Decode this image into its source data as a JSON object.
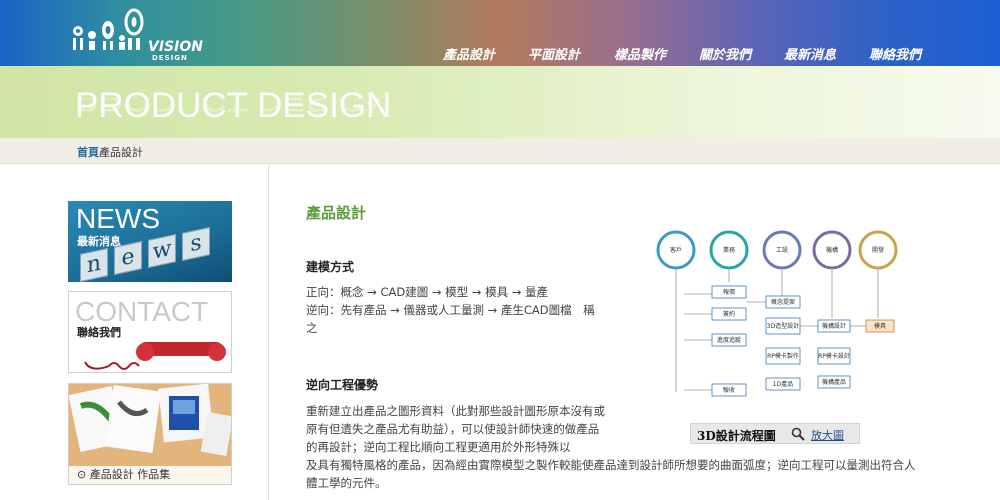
{
  "brand": {
    "name": "VISION",
    "sub": "DESIGN"
  },
  "nav": [
    {
      "label": "產品設計"
    },
    {
      "label": "平面設計"
    },
    {
      "label": "樣品製作"
    },
    {
      "label": "關於我們"
    },
    {
      "label": "最新消息"
    },
    {
      "label": "聯絡我們"
    }
  ],
  "banner": {
    "title": "PRODUCT DESIGN"
  },
  "breadcrumb": {
    "home": "首頁",
    "current": "產品設計"
  },
  "sidebar": {
    "news": {
      "big": "NEWS",
      "sub": "最新消息",
      "keys": [
        "n",
        "e",
        "w",
        "s"
      ]
    },
    "contact": {
      "big": "CONTACT",
      "sub": "聯絡我們"
    },
    "works": {
      "label": "產品設計 作品集"
    }
  },
  "content": {
    "title": "產品設計",
    "modeling_heading": "建模方式",
    "forward": "正向：概念 → CAD建圖 → 模型 → 模具 → 量產",
    "reverse": "逆向：先有產品 → 儀器或人工量測 → 產生CAD圖檔　稱之",
    "advantage_heading": "逆向工程優勢",
    "advantage_text": "重新建立出產品之圖形資料（此對那些設計圖形原本沒有或原有但遺失之產品尤有助益），可以使設計師快速的做產品的再設計；逆向工程比順向工程更適用於外形特殊以",
    "advantage_tail": "及具有獨特風格的產品，因為經由實際模型之製作較能使產品達到設計師所想要的曲面弧度；逆向工程可以量測出符合人體工學的元件。"
  },
  "diagram": {
    "caption": "3D設計流程圖",
    "zoom_label": "放大圖",
    "stages": [
      "客戶",
      "業務",
      "工設",
      "機構",
      "開發"
    ],
    "boxes": [
      "報價",
      "簽約",
      "進度追蹤",
      "驗收",
      "概念提案",
      "3D造型設計",
      "RP模卡製作",
      "1D產品",
      "機構設計",
      "RP模卡設計",
      "機構產品",
      "模具"
    ]
  },
  "colors": {
    "accent_green": "#5a9e3c",
    "link_blue": "#1e6aa8"
  }
}
